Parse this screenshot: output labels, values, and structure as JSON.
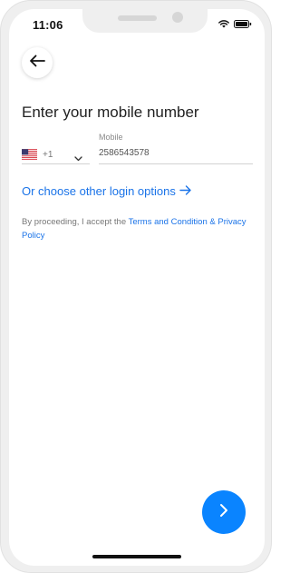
{
  "status_bar": {
    "time": "11:06",
    "icons": [
      "wifi-icon",
      "battery-icon"
    ]
  },
  "header": {
    "back_icon": "arrow-left-icon"
  },
  "main": {
    "heading": "Enter your mobile number",
    "country": {
      "flag": "us-flag-icon",
      "dial_code": "+1",
      "chevron": "chevron-down-icon"
    },
    "mobile": {
      "label": "Mobile",
      "value": "2586543578"
    },
    "other_login_link": "Or choose other login options",
    "other_login_icon": "arrow-right-icon",
    "terms": {
      "prefix": "By proceeding, I accept the",
      "link": "Terms and Condition & Privacy Policy"
    }
  },
  "footer": {
    "next_icon": "chevron-right-icon"
  },
  "colors": {
    "accent": "#0a84ff",
    "link": "#1a73e8",
    "text": "#222222",
    "muted": "#777777"
  }
}
